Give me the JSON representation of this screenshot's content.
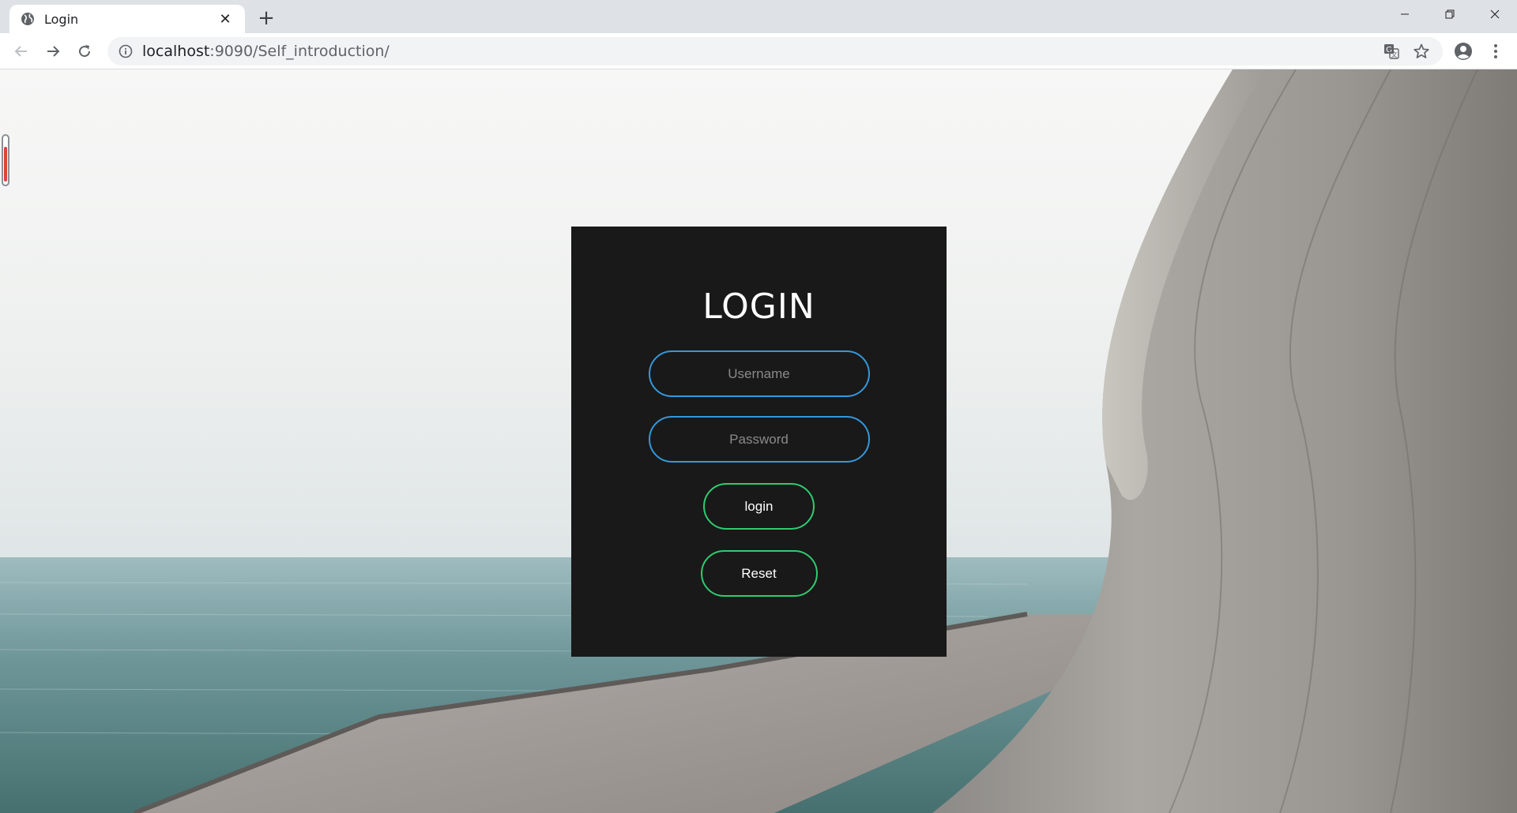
{
  "browser": {
    "tab_title": "Login",
    "tab_close_glyph": "✕",
    "new_tab_glyph": "+",
    "url_host": "localhost",
    "url_rest": ":9090/Self_introduction/"
  },
  "icons": {
    "favicon": "globe-icon",
    "back": "back-arrow-icon",
    "forward": "forward-arrow-icon",
    "reload": "reload-icon",
    "site_info": "info-icon",
    "translate": "translate-icon",
    "bookmark": "star-icon",
    "profile": "profile-icon",
    "menu": "kebab-menu-icon"
  },
  "login": {
    "title": "LOGIN",
    "username_placeholder": "Username",
    "password_placeholder": "Password",
    "login_button": "login",
    "reset_button": "Reset"
  },
  "colors": {
    "card_background": "#191919",
    "input_border": "#3498db",
    "button_border": "#2ecc71"
  }
}
